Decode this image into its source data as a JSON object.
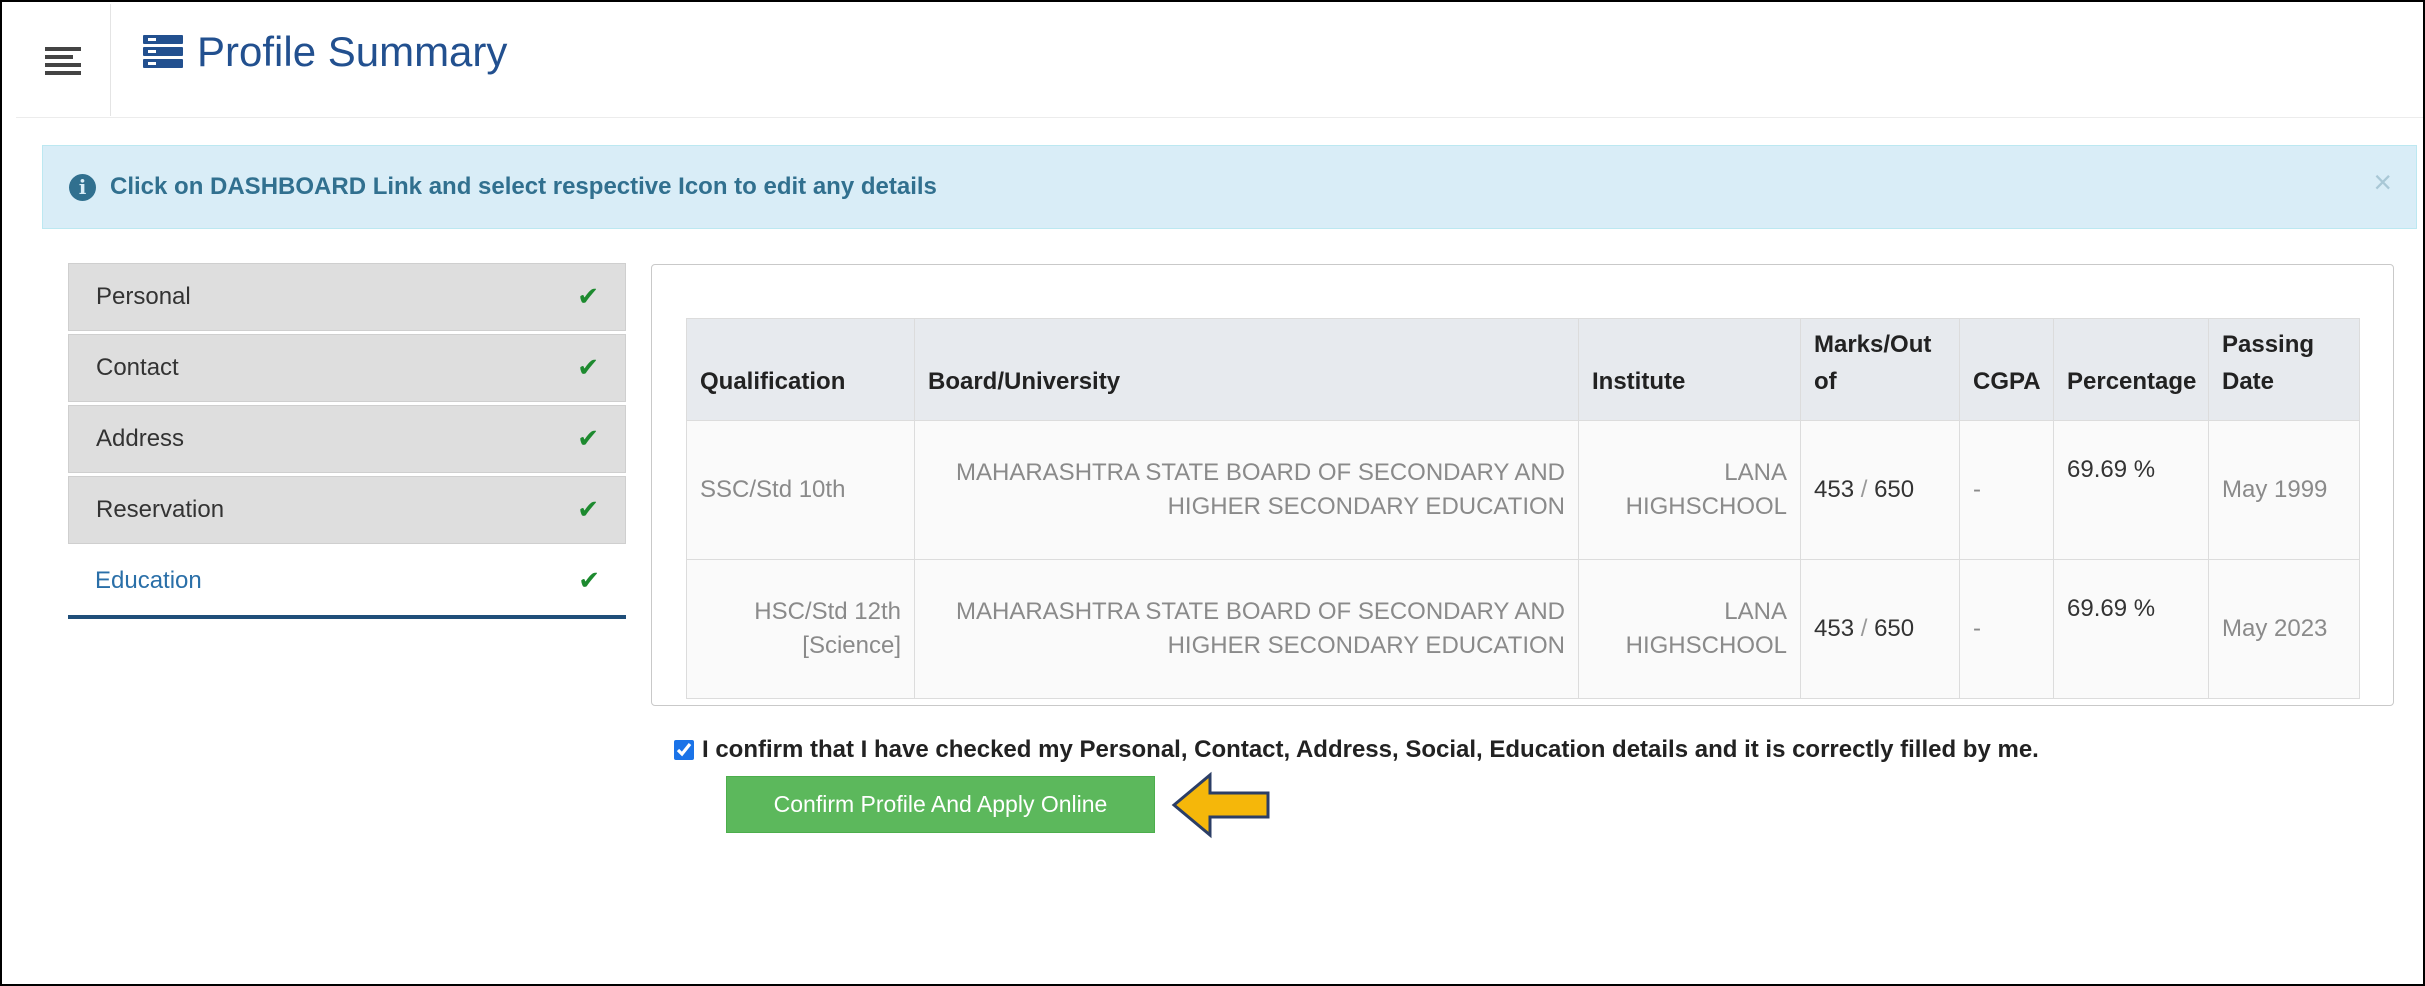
{
  "header": {
    "title": "Profile Summary",
    "menu_icon": "hamburger-menu-icon",
    "title_icon": "list-icon",
    "title_color": "#22508f"
  },
  "alert": {
    "text": "Click on DASHBOARD Link and select respective Icon to edit any details",
    "close": "×",
    "info_icon": "i"
  },
  "tabs": [
    {
      "label": "Personal",
      "complete": true
    },
    {
      "label": "Contact",
      "complete": true
    },
    {
      "label": "Address",
      "complete": true
    },
    {
      "label": "Reservation",
      "complete": true
    },
    {
      "label": "Education",
      "complete": true,
      "active": true
    }
  ],
  "check_mark": "✔",
  "education": {
    "headers": [
      "Qualification",
      "Board/University",
      "Institute",
      "Marks/Out of",
      "CGPA",
      "Percentage",
      "Passing Date"
    ],
    "rows": [
      {
        "qualification": "SSC/Std 10th",
        "board": "MAHARASHTRA STATE BOARD OF SECONDARY AND HIGHER SECONDARY EDUCATION",
        "institute": "LANA HIGHSCHOOL",
        "marks": "453",
        "out_of": "650",
        "cgpa": "-",
        "percentage": "69.69 %",
        "passing_date": "May 1999"
      },
      {
        "qualification": "HSC/Std 12th [Science]",
        "board": "MAHARASHTRA STATE BOARD OF SECONDARY AND HIGHER SECONDARY EDUCATION",
        "institute": "LANA HIGHSCHOOL",
        "marks": "453",
        "out_of": "650",
        "cgpa": "-",
        "percentage": "69.69 %",
        "passing_date": "May 2023"
      }
    ]
  },
  "confirm": {
    "checked": true,
    "text": "I confirm that I have checked my Personal, Contact, Address, Social, Education details and it is correctly filled by me.",
    "button_label": "Confirm Profile And Apply Online",
    "button_color": "#5cb85c"
  },
  "annotation": {
    "arrow_icon": "arrow-left-icon",
    "arrow_color": "#f5b70a"
  }
}
